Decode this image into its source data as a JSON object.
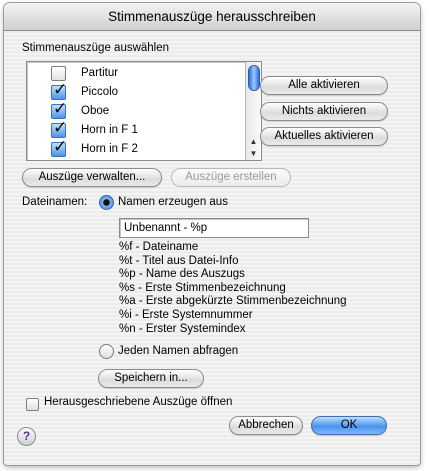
{
  "window": {
    "title": "Stimmenauszüge herausschreiben"
  },
  "parts_section": {
    "label": "Stimmenauszüge auswählen",
    "items": [
      {
        "label": "Partitur",
        "checked": false
      },
      {
        "label": "Piccolo",
        "checked": true
      },
      {
        "label": "Oboe",
        "checked": true
      },
      {
        "label": "Horn in F 1",
        "checked": true
      },
      {
        "label": "Horn in F 2",
        "checked": true
      }
    ]
  },
  "side_buttons": {
    "activate_all": "Alle aktivieren",
    "deactivate_all": "Nichts aktivieren",
    "activate_current": "Aktuelles aktivieren"
  },
  "action_buttons": {
    "manage": "Auszüge verwalten...",
    "create": "Auszüge erstellen"
  },
  "filenames": {
    "label": "Dateinamen:",
    "generate_option": "Namen erzeugen aus",
    "generate_selected": true,
    "pattern_value": "Unbenannt - %p",
    "codes": [
      "%f  - Dateiname",
      "%t  - Titel aus Datei-Info",
      "%p  - Name des Auszugs",
      "%s  - Erste Stimmenbezeichnung",
      "%a  - Erste abgekürzte Stimmenbezeichnung",
      "%i  - Erste Systemnummer",
      "%n  - Erster Systemindex"
    ],
    "ask_option": "Jeden Namen abfragen",
    "save_in": "Speichern in..."
  },
  "open_after": {
    "label": "Herausgeschriebene Auszüge öffnen",
    "checked": false
  },
  "footer": {
    "help": "?",
    "cancel": "Abbrechen",
    "ok": "OK"
  },
  "colors": {
    "accent": "#4a93ee",
    "help_glyph": "#5a2fa8"
  }
}
